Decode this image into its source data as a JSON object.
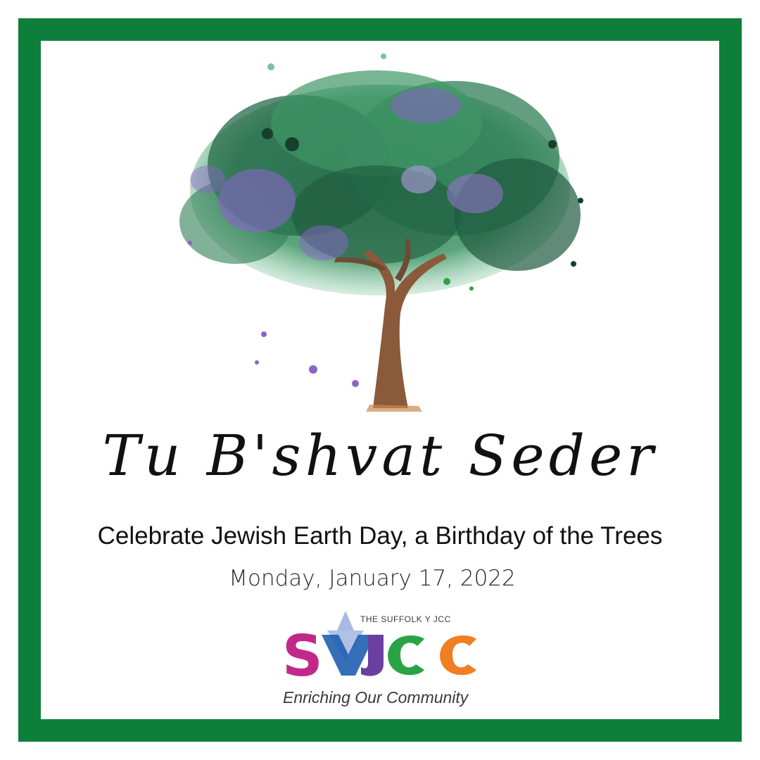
{
  "event": {
    "title": "Tu B'shvat Seder",
    "subtitle": "Celebrate Jewish Earth Day, a Birthday of the Trees",
    "date": "Monday, January 17, 2022"
  },
  "organization": {
    "tagline": "THE SUFFOLK Y JCC",
    "motto": "Enriching Our Community",
    "logo_letters": "SYJCC"
  },
  "colors": {
    "border": "#0d7f3a",
    "logo_magenta": "#c2288a",
    "logo_blue": "#1f5fb0",
    "logo_purple": "#6a3fa1",
    "logo_green": "#2aa345",
    "logo_orange": "#ef7f22",
    "tree_green": "#2f7d55",
    "tree_purple": "#8b63c9",
    "trunk": "#8a5a3a"
  },
  "icons": {
    "illustration": "watercolor-tree-illustration",
    "logo": "syjcc-logo"
  }
}
